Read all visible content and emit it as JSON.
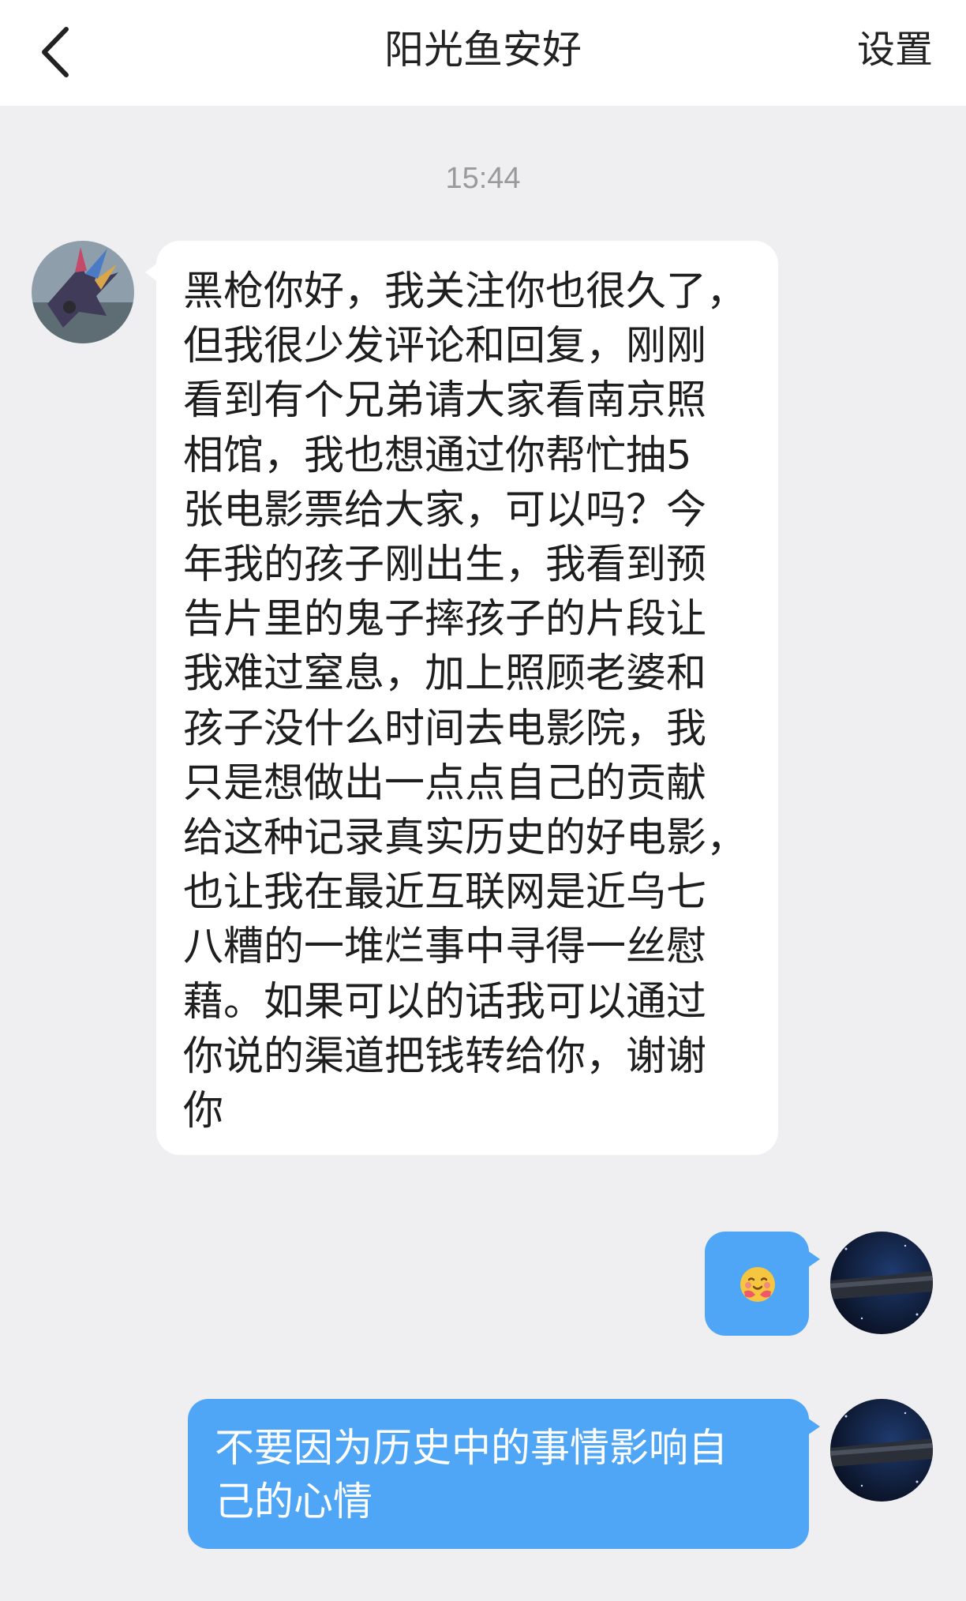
{
  "header": {
    "title": "阳光鱼安好",
    "settings_label": "设置",
    "back_icon": "chevron-left-icon"
  },
  "timestamp": "15:44",
  "messages": [
    {
      "direction": "incoming",
      "avatar": "bird-avatar",
      "lines": [
        "黑枪你好，我关注你也很久了，",
        "但我很少发评论和回复，刚刚",
        "看到有个兄弟请大家看南京照",
        "相馆，我也想通过你帮忙抽5",
        "张电影票给大家，可以吗？今",
        "年我的孩子刚出生，我看到预",
        "告片里的鬼子摔孩子的片段让",
        "我难过窒息，加上照顾老婆和",
        "孩子没什么时间去电影院，我",
        "只是想做出一点点自己的贡献",
        "给这种记录真实历史的好电影，",
        "也让我在最近互联网是近乌七",
        "八糟的一堆烂事中寻得一丝慰",
        "藉。如果可以的话我可以通过",
        "你说的渠道把钱转给你，谢谢",
        "你"
      ]
    },
    {
      "direction": "outgoing",
      "avatar": "space-avatar",
      "emoji": "hugging-face-emoji"
    },
    {
      "direction": "outgoing",
      "avatar": "space-avatar",
      "lines": [
        "不要因为历史中的事情影响自",
        "己的心情"
      ]
    }
  ],
  "colors": {
    "background": "#efeff1",
    "header": "#ffffff",
    "incoming_bubble": "#ffffff",
    "outgoing_bubble": "#4fa6f6",
    "timestamp": "#9a9a9a"
  }
}
